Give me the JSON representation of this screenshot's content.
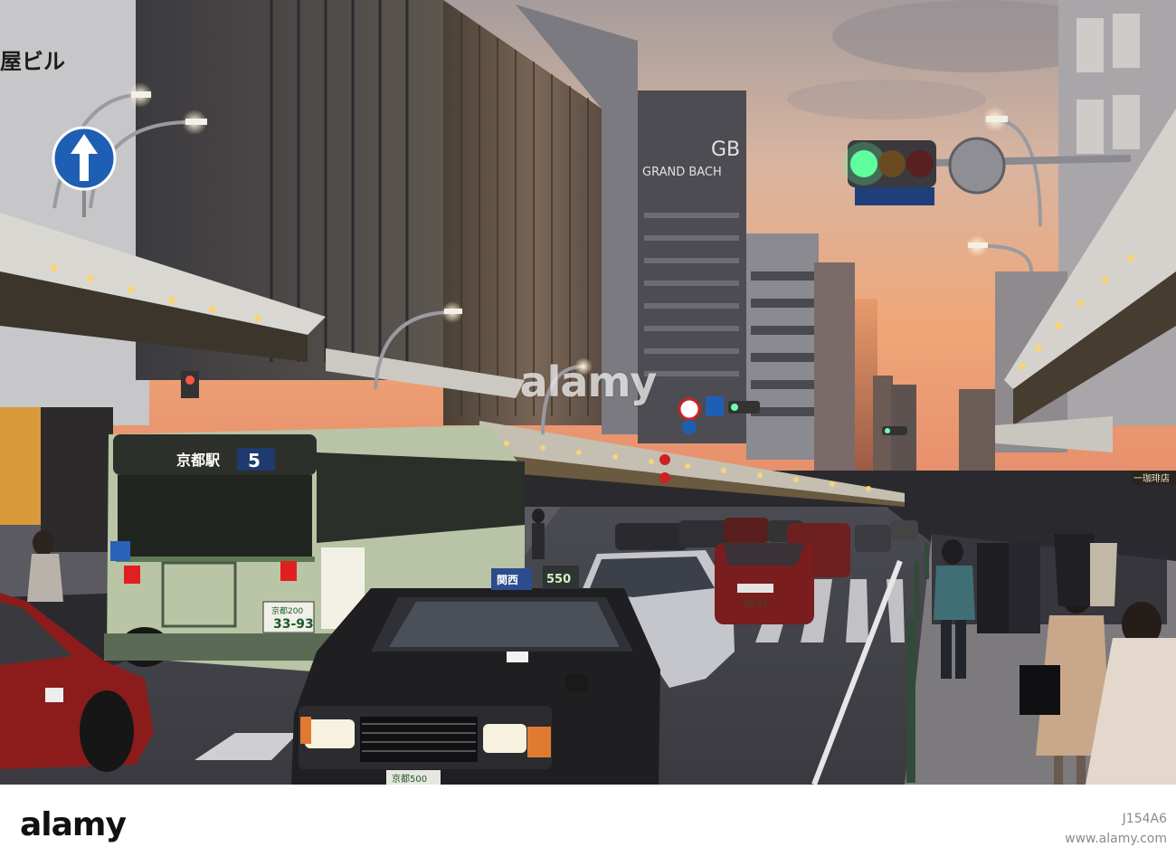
{
  "photo": {
    "description_signs": {
      "building_sign": "屋ビル",
      "hotel_sign": "GRAND BACH",
      "hotel_monogram": "GB",
      "bus_destination": "京都駅",
      "bus_route_number": "5",
      "bus_plate_number": "33-93",
      "bus_plate_region": "京都200",
      "taxi_roof_sign": "関西",
      "taxi_roof_number": "550",
      "taxi_plate": "京都500",
      "far_taxi_plate": "29-53",
      "right_shop_sign": "一珈琲店"
    },
    "traffic_light_active": "green"
  },
  "watermark": {
    "text": "alamy"
  },
  "footer": {
    "logo_text": "alamy",
    "image_id": "J154A6",
    "url": "www.alamy.com"
  },
  "colors": {
    "sky_top": "#b9a9a6",
    "sky_glow": "#f0a77a",
    "bus_body": "#b8c4a5",
    "taxi_black": "#1f1f22",
    "taxi_red": "#9a1f1f",
    "canopy_light": "#f3d68a"
  }
}
